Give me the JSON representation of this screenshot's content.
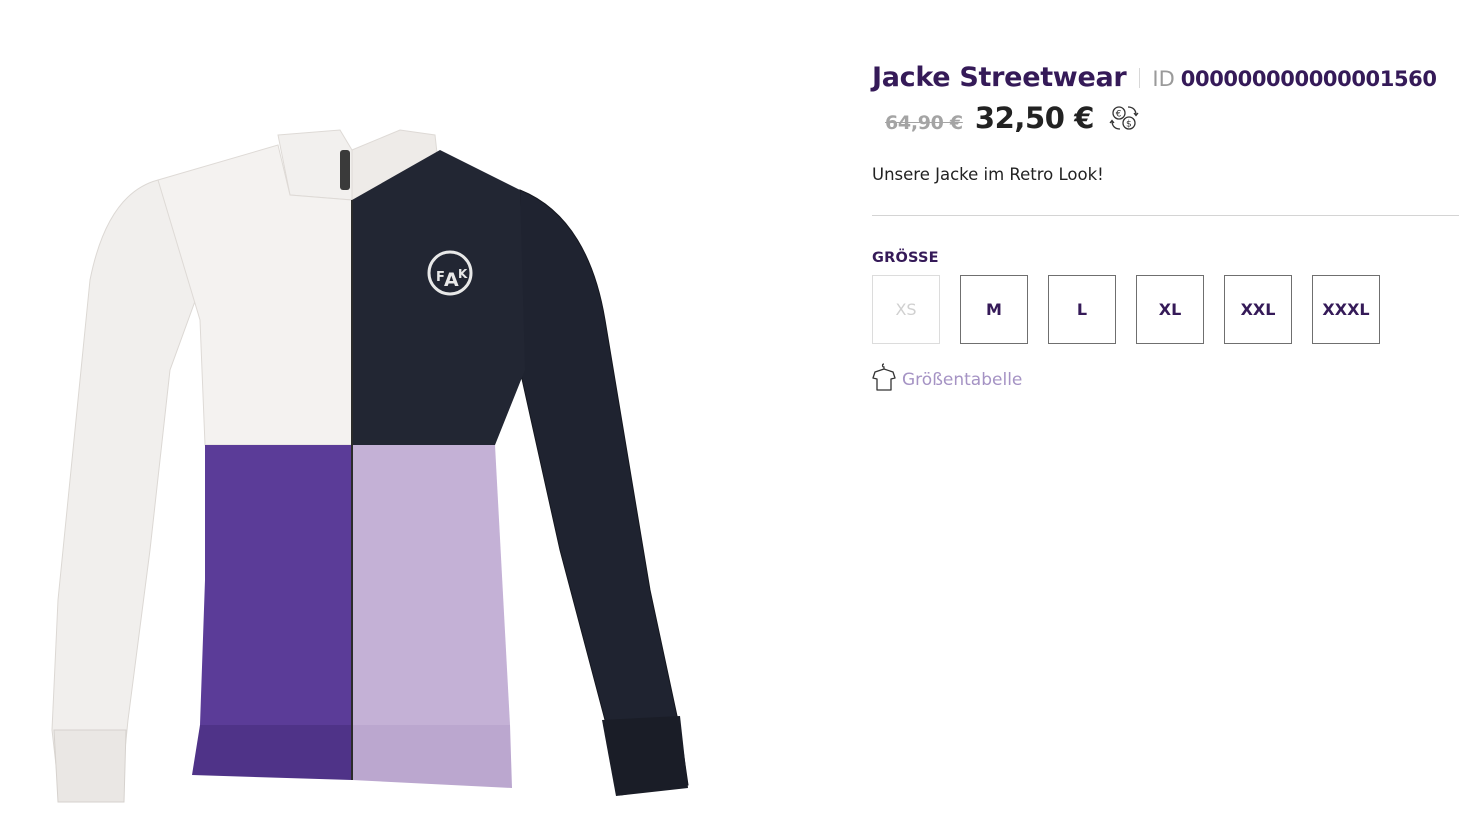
{
  "product": {
    "title": "Jacke Streetwear",
    "id_label": "ID",
    "id_value": "000000000000001560",
    "old_price": "64,90 €",
    "new_price": "32,50 €",
    "description": "Unsere Jacke im Retro Look!",
    "image_icon": "zip-jacket-product-image"
  },
  "size": {
    "label": "GRÖSSE",
    "options": [
      {
        "label": "XS",
        "available": false
      },
      {
        "label": "M",
        "available": true
      },
      {
        "label": "L",
        "available": true
      },
      {
        "label": "XL",
        "available": true
      },
      {
        "label": "XXL",
        "available": true
      },
      {
        "label": "XXXL",
        "available": true
      }
    ],
    "chart_link": "Größentabelle"
  },
  "icons": {
    "currency": "currency-convert-icon",
    "size_chart": "shirt-hanger-icon"
  },
  "colors": {
    "brand": "#351a58",
    "link": "#a593c4",
    "muted": "#a4a4a4"
  }
}
